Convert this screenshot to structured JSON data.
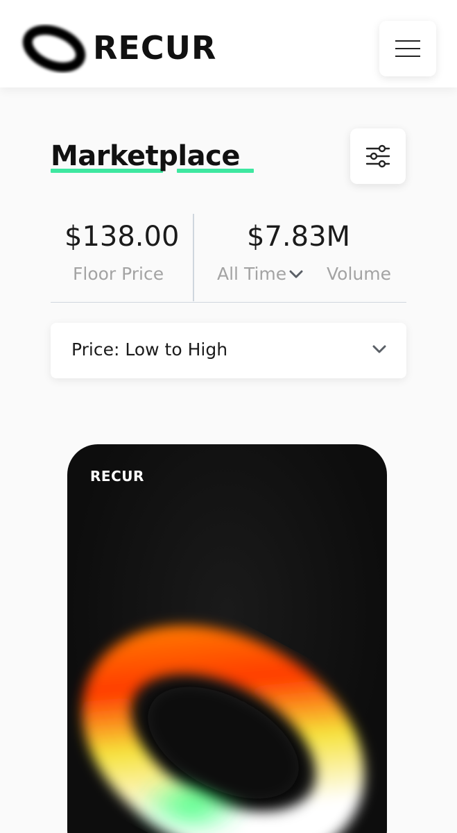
{
  "header": {
    "logo_text": "RECUR",
    "logo_icon": "ring-logo-icon",
    "menu_icon": "hamburger-menu-icon"
  },
  "page": {
    "title": "Marketplace",
    "filter_icon": "sliders-filter-icon",
    "accent_color": "#3ee7a0"
  },
  "stats": {
    "floor_price": {
      "value": "$138.00",
      "label": "Floor Price"
    },
    "volume": {
      "value": "$7.83M",
      "range_label": "All Time",
      "label": "Volume"
    }
  },
  "sort": {
    "selected": "Price: Low to High"
  },
  "card": {
    "brand": "RECUR"
  }
}
